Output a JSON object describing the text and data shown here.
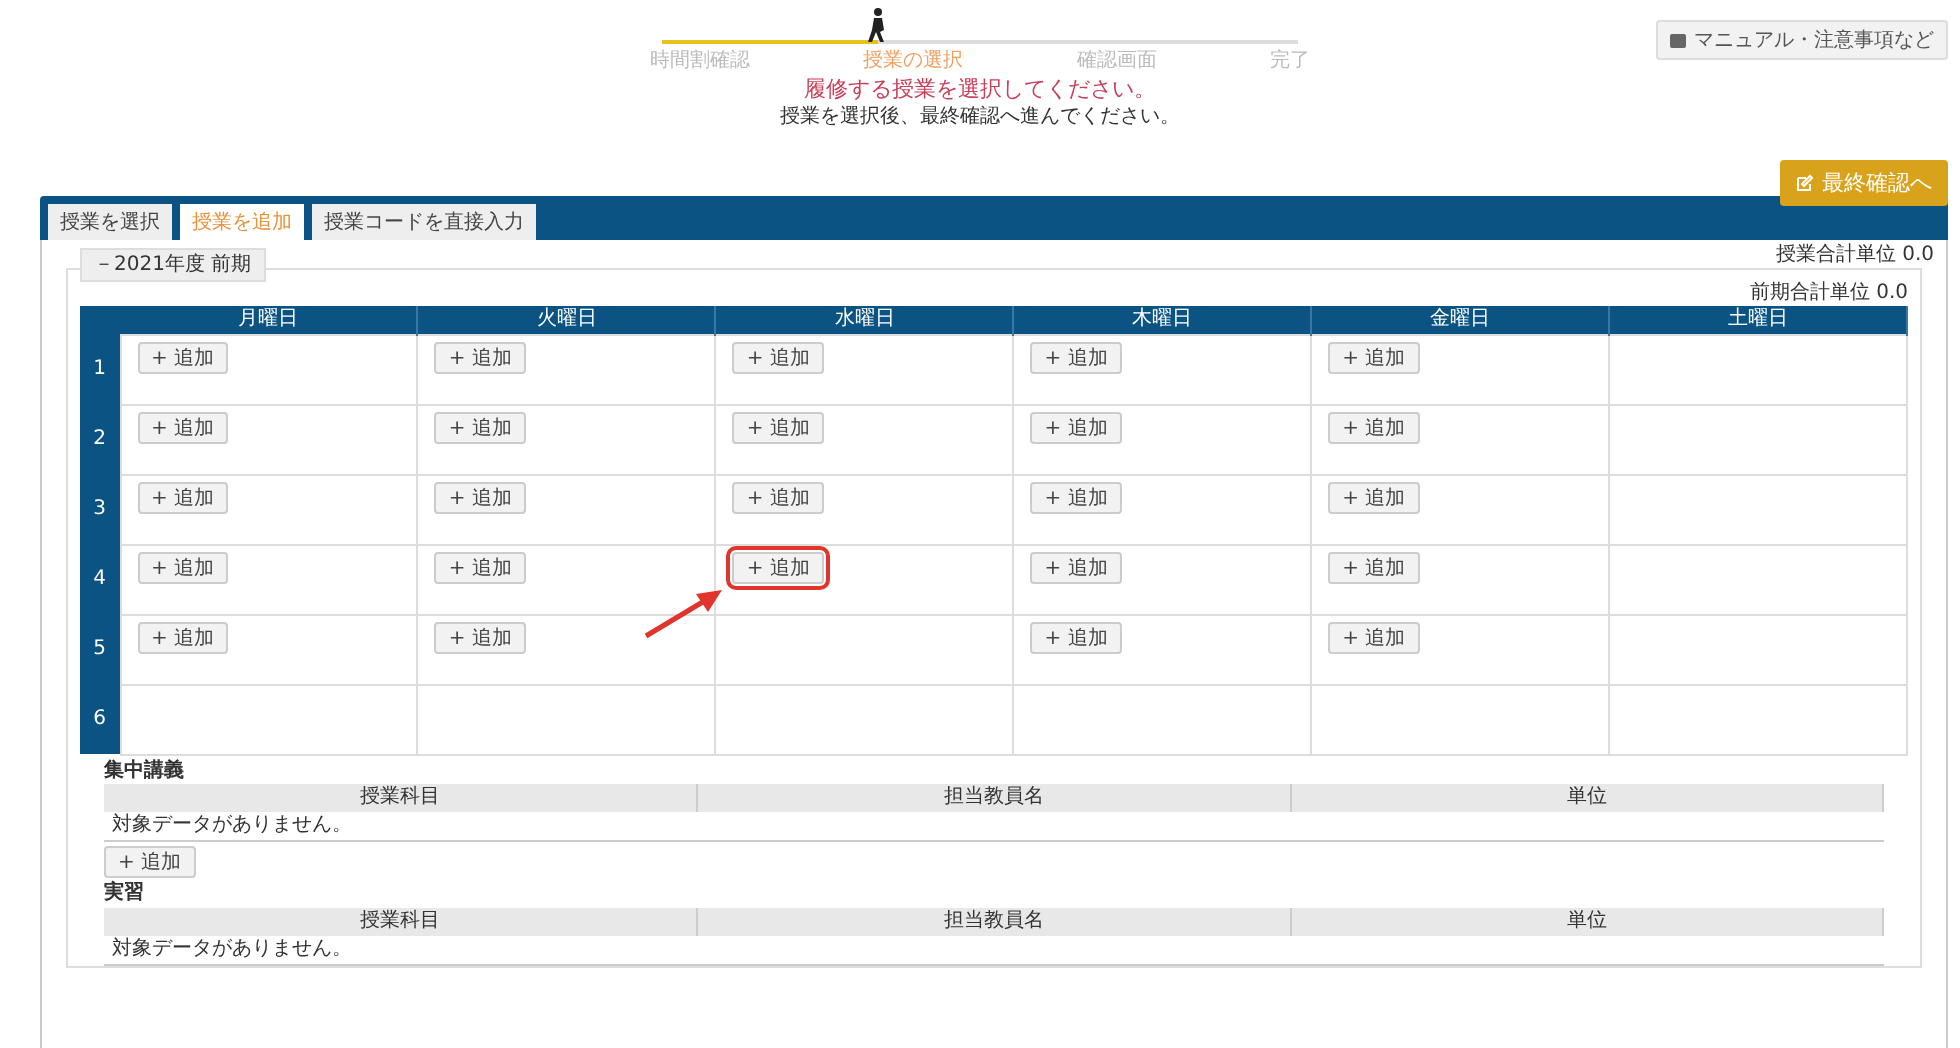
{
  "manual_button": "マニュアル・注意事項など",
  "progress": {
    "level": 0.34,
    "steps": [
      {
        "label": "時間割確認",
        "selected": false
      },
      {
        "label": "授業の選択",
        "selected": true
      },
      {
        "label": "確認画面",
        "selected": false
      },
      {
        "label": "完了",
        "selected": false
      }
    ]
  },
  "message": "履修する授業を選択してください。",
  "sub_message": "授業を選択後、最終確認へ進んでください。",
  "confirm_button": "最終確認へ",
  "tabs": [
    {
      "label": "授業を選択",
      "selected": false
    },
    {
      "label": "授業を追加",
      "selected": true
    },
    {
      "label": "授業コードを直接入力",
      "selected": false
    }
  ],
  "total_credits": "授業合計単位 0.0",
  "term": {
    "legend": "－2021年度 前期",
    "credits": "前期合計単位 0.0",
    "days": [
      "月曜日",
      "火曜日",
      "水曜日",
      "木曜日",
      "金曜日",
      "土曜日"
    ],
    "periods": [
      {
        "label": "1",
        "cells": [
          {
            "kind": "add",
            "text": "+ 追加",
            "highlighted": false
          },
          {
            "kind": "add",
            "text": "+ 追加",
            "highlighted": false
          },
          {
            "kind": "add",
            "text": "+ 追加",
            "highlighted": false
          },
          {
            "kind": "add",
            "text": "+ 追加",
            "highlighted": false
          },
          {
            "kind": "add",
            "text": "+ 追加",
            "highlighted": false
          },
          {
            "kind": "empty"
          }
        ]
      },
      {
        "label": "2",
        "cells": [
          {
            "kind": "add",
            "text": "+ 追加",
            "highlighted": false
          },
          {
            "kind": "add",
            "text": "+ 追加",
            "highlighted": false
          },
          {
            "kind": "add",
            "text": "+ 追加",
            "highlighted": false
          },
          {
            "kind": "add",
            "text": "+ 追加",
            "highlighted": false
          },
          {
            "kind": "add",
            "text": "+ 追加",
            "highlighted": false
          },
          {
            "kind": "empty"
          }
        ]
      },
      {
        "label": "3",
        "cells": [
          {
            "kind": "add",
            "text": "+ 追加",
            "highlighted": false
          },
          {
            "kind": "add",
            "text": "+ 追加",
            "highlighted": false
          },
          {
            "kind": "add",
            "text": "+ 追加",
            "highlighted": false
          },
          {
            "kind": "add",
            "text": "+ 追加",
            "highlighted": false
          },
          {
            "kind": "add",
            "text": "+ 追加",
            "highlighted": false
          },
          {
            "kind": "empty"
          }
        ]
      },
      {
        "label": "4",
        "cells": [
          {
            "kind": "add",
            "text": "+ 追加",
            "highlighted": false
          },
          {
            "kind": "add",
            "text": "+ 追加",
            "highlighted": false
          },
          {
            "kind": "add",
            "text": "+ 追加",
            "highlighted": true
          },
          {
            "kind": "add",
            "text": "+ 追加",
            "highlighted": false
          },
          {
            "kind": "add",
            "text": "+ 追加",
            "highlighted": false
          },
          {
            "kind": "empty"
          }
        ]
      },
      {
        "label": "5",
        "cells": [
          {
            "kind": "add",
            "text": "+ 追加",
            "highlighted": false
          },
          {
            "kind": "add",
            "text": "+ 追加",
            "highlighted": false
          },
          {
            "kind": "empty"
          },
          {
            "kind": "add",
            "text": "+ 追加",
            "highlighted": false
          },
          {
            "kind": "add",
            "text": "+ 追加",
            "highlighted": false
          },
          {
            "kind": "empty"
          }
        ]
      },
      {
        "label": "6",
        "cells": [
          {
            "kind": "empty"
          },
          {
            "kind": "empty"
          },
          {
            "kind": "empty"
          },
          {
            "kind": "empty"
          },
          {
            "kind": "empty"
          },
          {
            "kind": "empty"
          }
        ]
      }
    ]
  },
  "sections": [
    {
      "title": "集中講義",
      "columns": [
        "授業科目",
        "担当教員名",
        "単位"
      ],
      "empty_text": "対象データがありません。",
      "add_button": "+ 追加"
    },
    {
      "title": "実習",
      "columns": [
        "授業科目",
        "担当教員名",
        "単位"
      ],
      "empty_text": "対象データがありません。"
    }
  ]
}
